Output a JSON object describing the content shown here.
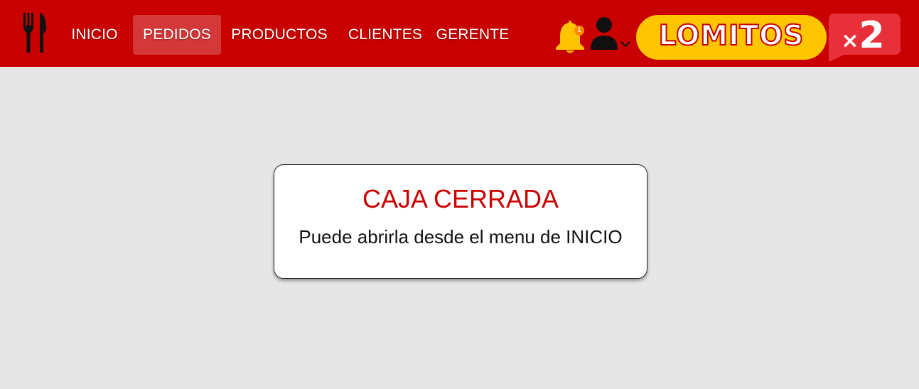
{
  "colors": {
    "navbar": "#c80000",
    "background": "#e6e6e6",
    "accent_yellow": "#ffc600",
    "badge_red": "#e8303a"
  },
  "navbar": {
    "logo_icon": "fork-knife-icon",
    "items": [
      {
        "label": "INICIO",
        "active": false
      },
      {
        "label": "PEDIDOS",
        "active": true
      },
      {
        "label": "PRODUCTOS",
        "active": false
      },
      {
        "label": "CLIENTES",
        "active": false
      },
      {
        "label": "GERENTE",
        "active": false
      }
    ],
    "notifications": {
      "icon": "bell-icon",
      "count": "1"
    },
    "user_menu": {
      "icon": "user-icon",
      "caret": "chevron-down-icon"
    },
    "promo": {
      "text": "LOMITOS",
      "multiplier_symbol": "×",
      "multiplier": "2"
    }
  },
  "notice": {
    "title": "CAJA CERRADA",
    "message": "Puede abrirla desde el menu de INICIO"
  }
}
